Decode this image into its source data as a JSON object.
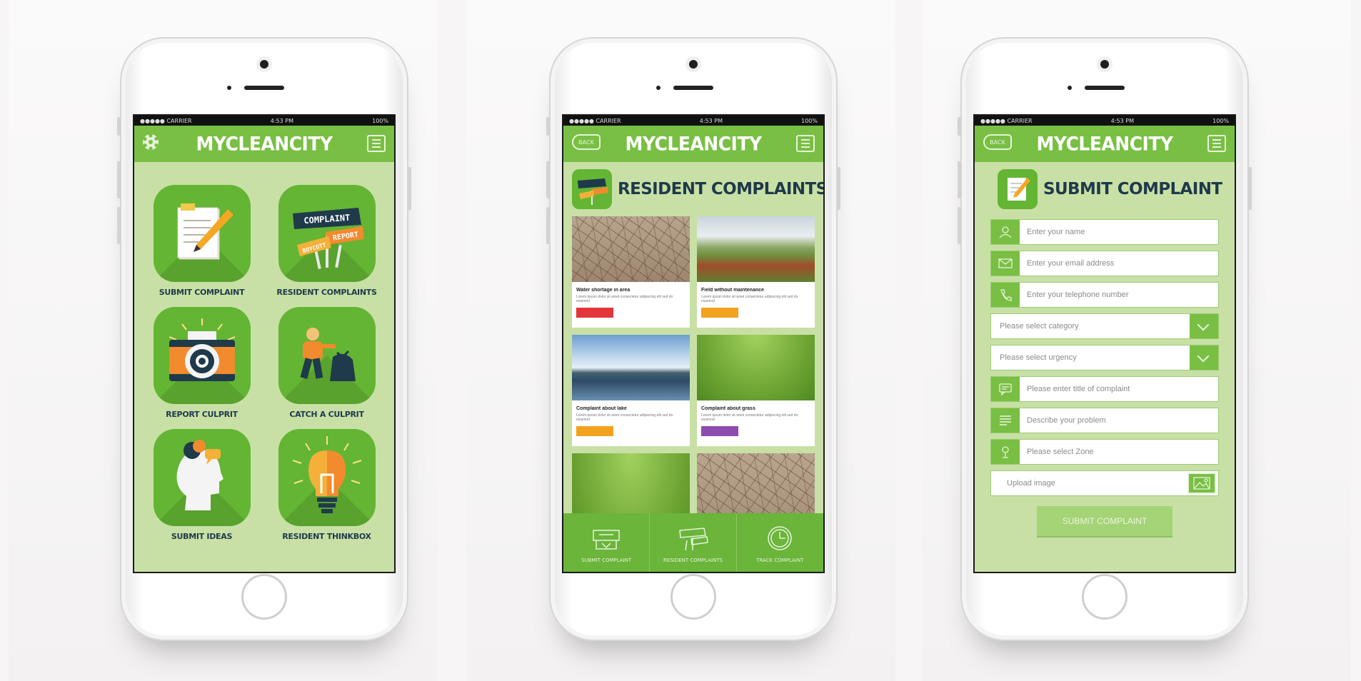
{
  "status_bar": {
    "carrier": "●●●●● CARRIER",
    "time": "4:53 PM",
    "battery": "100%"
  },
  "app": {
    "title": "MYCLEANCITY",
    "back_label": "BACK"
  },
  "menu": {
    "tiles": [
      {
        "label": "SUBMIT COMPLAINT",
        "icon": "clipboard-pencil-icon"
      },
      {
        "label": "RESIDENT COMPLAINTS",
        "icon": "complaint-signs-icon",
        "sign_1": "COMPLAINT",
        "sign_2": "REPORT",
        "sign_3": "BOYCOTT"
      },
      {
        "label": "REPORT CULPRIT",
        "icon": "camera-icon"
      },
      {
        "label": "CATCH A CULPRIT",
        "icon": "culprit-running-icon"
      },
      {
        "label": "SUBMIT IDEAS",
        "icon": "head-ideas-icon"
      },
      {
        "label": "RESIDENT THINKBOX",
        "icon": "lightbulb-icon"
      }
    ]
  },
  "complaints": {
    "title": "RESIDENT COMPLAINTS",
    "cards": [
      {
        "title": "Water shortage in area",
        "desc": "Lorem ipsum dolor sit amet consectetur adipiscing elit sed do eiusmod",
        "tag_color": "#e2363a",
        "image": "cracked-earth"
      },
      {
        "title": "Field without maintenance",
        "desc": "Lorem ipsum dolor sit amet consectetur adipiscing elit sed do eiusmod",
        "tag_color": "#f3a21f",
        "image": "poppy-field"
      },
      {
        "title": "Complaint about lake",
        "desc": "Lorem ipsum dolor sit amet consectetur adipiscing elit sed do eiusmod",
        "tag_color": "#f3a21f",
        "image": "lake"
      },
      {
        "title": "Complaint about grass",
        "desc": "Lorem ipsum dolor sit amet consectetur adipiscing elit sed do eiusmod",
        "tag_color": "#8e4bb0",
        "image": "grass"
      },
      {
        "title": "",
        "desc": "",
        "tag_color": "",
        "image": "grass"
      },
      {
        "title": "",
        "desc": "",
        "tag_color": "",
        "image": "cracked-earth"
      }
    ],
    "bottom_nav": [
      {
        "label": "SUBMIT COMPLAINT",
        "icon": "inbox-icon"
      },
      {
        "label": "RESIDENT COMPLAINTS",
        "icon": "signs-icon"
      },
      {
        "label": "TRACK COMPLAINT",
        "icon": "clock-icon"
      }
    ]
  },
  "submit": {
    "title": "SUBMIT COMPLAINT",
    "fields": [
      {
        "placeholder": "Enter your name",
        "icon": "user-icon"
      },
      {
        "placeholder": "Enter your email address",
        "icon": "envelope-icon"
      },
      {
        "placeholder": "Enter your telephone number",
        "icon": "phone-icon"
      }
    ],
    "select_category": "Please select category",
    "select_urgency": "Please select urgency",
    "fields_2": [
      {
        "placeholder": "Please enter title of complaint",
        "icon": "speech-bubble-icon"
      },
      {
        "placeholder": "Describe your problem",
        "icon": "lines-icon"
      },
      {
        "placeholder": "Please select Zone",
        "icon": "location-pin-icon"
      }
    ],
    "upload_label": "Upload image",
    "button_label": "SUBMIT COMPLAINT"
  },
  "colors": {
    "green": "#78bf43",
    "dark_green": "#63b533",
    "screen_bg": "#c8e0a6",
    "navy_text": "#1f3a4a"
  }
}
